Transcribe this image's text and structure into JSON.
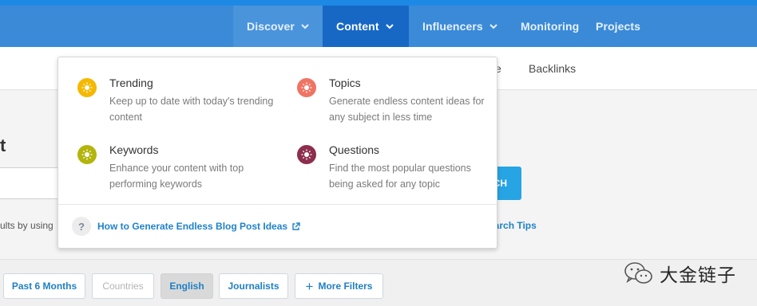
{
  "nav": {
    "discover": "Discover",
    "content": "Content",
    "influencers": "Influencers",
    "monitoring": "Monitoring",
    "projects": "Projects"
  },
  "subnav": {
    "partial_item": "e",
    "backlinks": "Backlinks"
  },
  "page": {
    "title_partial": "t",
    "search_button_partial": "CH",
    "hint_partial": "ults by using",
    "tips_partial": "earch Tips"
  },
  "dropdown": {
    "items": [
      {
        "title": "Trending",
        "desc": "Keep up to date with today's trending content",
        "color": "#f5b800",
        "icon": "sun-icon"
      },
      {
        "title": "Topics",
        "desc": "Generate endless content ideas for any subject in less time",
        "color": "#f07463",
        "icon": "sun-icon"
      },
      {
        "title": "Keywords",
        "desc": "Enhance your content with top performing keywords",
        "color": "#b3b50c",
        "icon": "sun-icon"
      },
      {
        "title": "Questions",
        "desc": "Find the most popular questions being asked for any topic",
        "color": "#8d2e4e",
        "icon": "sun-icon"
      }
    ],
    "help_mark": "?",
    "help_link": "How to Generate Endless Blog Post Ideas"
  },
  "filters": {
    "past": "Past 6 Months",
    "countries": "Countries",
    "english": "English",
    "journalists": "Journalists",
    "more_plus": "+",
    "more": "More Filters"
  },
  "watermark": {
    "text": "大金链子"
  }
}
